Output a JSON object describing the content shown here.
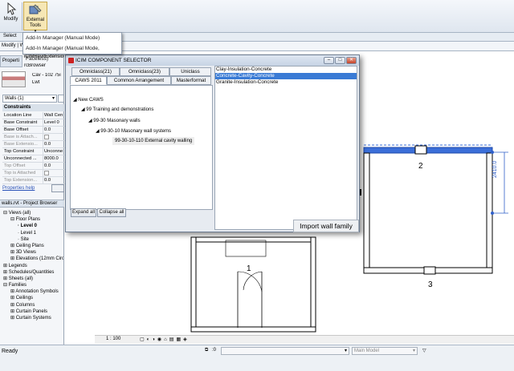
{
  "ribbon": {
    "modify_label": "Modify",
    "external_tools_line1": "External",
    "external_tools_line2": "Tools",
    "select_label": "Select",
    "modify_bar": "Modify | W"
  },
  "dropdown": {
    "items": [
      "Add-In Manager (Manual Mode)",
      "Add-In Manager (Manual Mode, Faceless)"
    ]
  },
  "left_panel": {
    "ext_items": [
      "iCIMRevitExtensio",
      "rcBrowser"
    ],
    "prop_tab": "Properti",
    "type_line1": "Cav - 102 75i",
    "type_line2": "Lwt",
    "type_selector": "Walls (1)",
    "section": "Constraints",
    "properties": [
      {
        "k": "Location Line",
        "v": "Wall Cen",
        "gray": false,
        "check": false
      },
      {
        "k": "Base Constraint",
        "v": "Level 0",
        "gray": false,
        "check": false
      },
      {
        "k": "Base Offset",
        "v": "0.0",
        "gray": false,
        "check": false
      },
      {
        "k": "Base is Attach...",
        "v": "",
        "gray": true,
        "check": true
      },
      {
        "k": "Base Extensio...",
        "v": "0.0",
        "gray": true,
        "check": false
      },
      {
        "k": "Top Constraint",
        "v": "Unconne",
        "gray": false,
        "check": false
      },
      {
        "k": "Unconnected ...",
        "v": "8000.0",
        "gray": false,
        "check": false
      },
      {
        "k": "Top Offset",
        "v": "0.0",
        "gray": true,
        "check": false
      },
      {
        "k": "Top is Attached",
        "v": "",
        "gray": true,
        "check": true
      },
      {
        "k": "Top Extension...",
        "v": "0.0",
        "gray": true,
        "check": false
      }
    ],
    "properties_help": "Properties help",
    "browser_title": "walls.rvt - Project Browser",
    "tree": [
      {
        "t": "Views (all)",
        "i": 0,
        "e": "⊟"
      },
      {
        "t": "Floor Plans",
        "i": 1,
        "e": "⊟"
      },
      {
        "t": "Level 0",
        "i": 2,
        "e": "",
        "b": true
      },
      {
        "t": "Level 1",
        "i": 2,
        "e": ""
      },
      {
        "t": "Site",
        "i": 2,
        "e": ""
      },
      {
        "t": "Ceiling Plans",
        "i": 1,
        "e": "⊞"
      },
      {
        "t": "3D Views",
        "i": 1,
        "e": "⊞"
      },
      {
        "t": "Elevations (12mm Circle)",
        "i": 1,
        "e": "⊞"
      },
      {
        "t": "Legends",
        "i": 0,
        "e": "⊞"
      },
      {
        "t": "Schedules/Quantities",
        "i": 0,
        "e": "⊞"
      },
      {
        "t": "Sheets (all)",
        "i": 0,
        "e": "⊞"
      },
      {
        "t": "Families",
        "i": 0,
        "e": "⊟"
      },
      {
        "t": "Annotation Symbols",
        "i": 1,
        "e": "⊞"
      },
      {
        "t": "Ceilings",
        "i": 1,
        "e": "⊞"
      },
      {
        "t": "Columns",
        "i": 1,
        "e": "⊞"
      },
      {
        "t": "Curtain Panels",
        "i": 1,
        "e": "⊞"
      },
      {
        "t": "Curtain Systems",
        "i": 1,
        "e": "⊞"
      }
    ]
  },
  "dialog": {
    "title": "ICIM COMPONENT SELECTOR",
    "tabs_row1": [
      "Omniclass(21)",
      "Omniclass(23)",
      "Uniclass"
    ],
    "tabs_row2": [
      "CAWS 2011",
      "Common Arrangement",
      "Masterformat"
    ],
    "tree": [
      "New CAWS",
      "99   Training and demonstrations",
      "99-30   Masonary walls",
      "99-30-10   Masonary wall systems",
      "99-30-10-110   External cavity walling"
    ],
    "expand_all": "Expand all",
    "collapse_all": "Collapse all",
    "families": [
      "Clay-Insulation-Concrete",
      "Concrete-Cavity-Concrete",
      "Granite-Insulation-Concrete"
    ],
    "selected_family": "Concrete-Cavity-Concrete",
    "import_button": "Import wall family"
  },
  "canvas": {
    "labels": [
      "1",
      "2",
      "3"
    ],
    "dimension": "2410.0"
  },
  "status": {
    "scale": "1 : 100",
    "ready": "Ready",
    "zero": ":0",
    "model": "Main Model"
  }
}
